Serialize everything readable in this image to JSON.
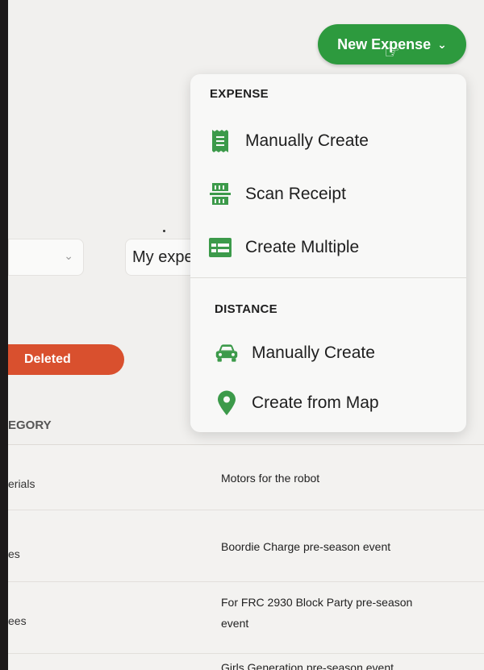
{
  "header": {
    "new_expense_label": "New Expense"
  },
  "filters": {
    "my_expenses_value": "My expe"
  },
  "status": {
    "deleted_label": "Deleted"
  },
  "table": {
    "category_header": "EGORY",
    "rows": [
      {
        "category": "erials",
        "description": "Motors for the robot"
      },
      {
        "category": "es",
        "description": "Boordie Charge pre-season event"
      },
      {
        "category": "ees",
        "description": "For FRC 2930 Block Party pre-season event"
      },
      {
        "category": "",
        "description": "Girls Generation pre-season event"
      }
    ]
  },
  "menu": {
    "expense_section": {
      "title": "EXPENSE",
      "items": [
        {
          "label": "Manually Create",
          "icon": "receipt-icon"
        },
        {
          "label": "Scan Receipt",
          "icon": "scan-receipt-icon"
        },
        {
          "label": "Create Multiple",
          "icon": "table-icon"
        }
      ]
    },
    "distance_section": {
      "title": "DISTANCE",
      "items": [
        {
          "label": "Manually Create",
          "icon": "car-icon"
        },
        {
          "label": "Create from Map",
          "icon": "map-pin-icon"
        }
      ]
    }
  },
  "colors": {
    "brand_green": "#2d9a3e",
    "deleted_red": "#d9502e",
    "icon_green": "#3c9a4a"
  }
}
